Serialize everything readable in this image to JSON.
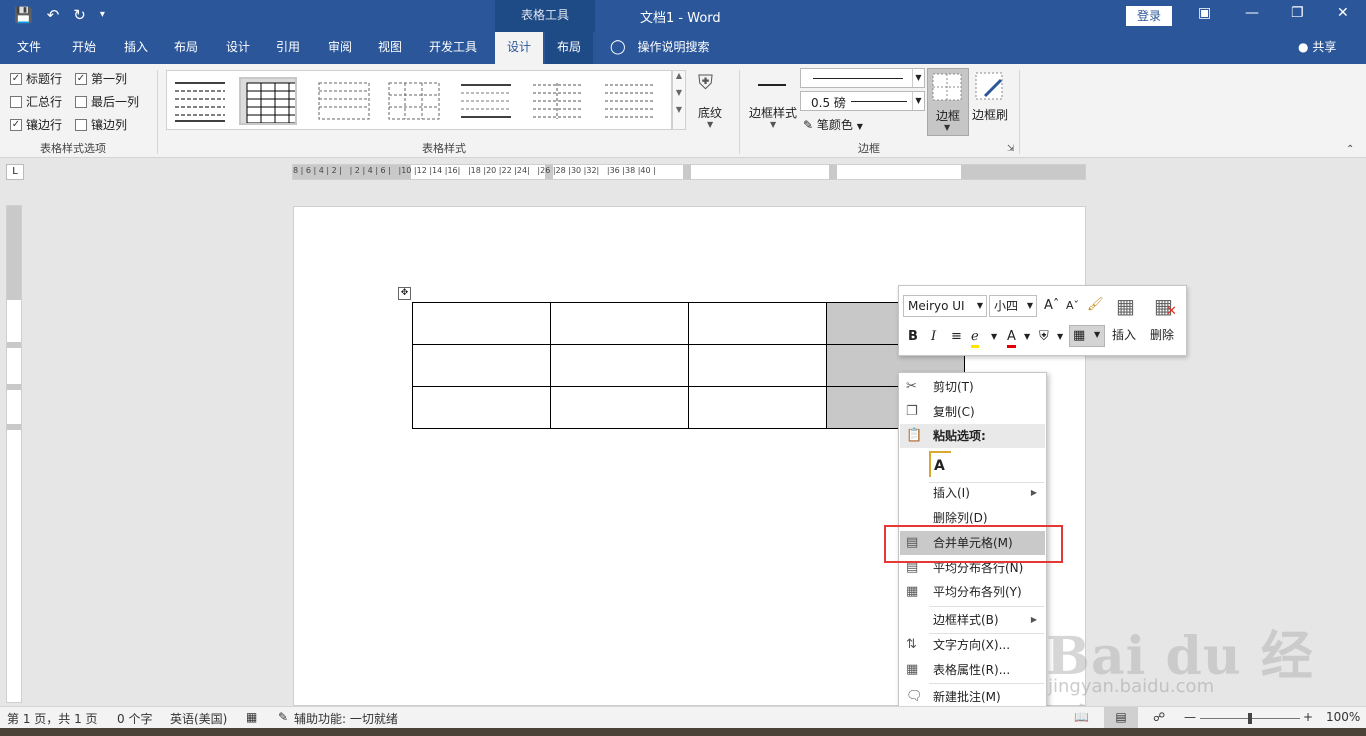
{
  "titlebar": {
    "context_tab": "表格工具",
    "doc_title": "文档1 - Word",
    "login": "登录"
  },
  "tabs": [
    "文件",
    "开始",
    "插入",
    "布局",
    "设计",
    "引用",
    "审阅",
    "视图",
    "开发工具",
    "设计",
    "布局"
  ],
  "search": "操作说明搜索",
  "share": "共享",
  "ribbon": {
    "checks": [
      {
        "label": "标题行",
        "checked": true
      },
      {
        "label": "汇总行",
        "checked": false
      },
      {
        "label": "镶边行",
        "checked": true
      },
      {
        "label": "第一列",
        "checked": true
      },
      {
        "label": "最后一列",
        "checked": false
      },
      {
        "label": "镶边列",
        "checked": false
      }
    ],
    "group_style_options": "表格样式选项",
    "group_table_styles": "表格样式",
    "shading": "底纹",
    "border_styles": "边框样式",
    "weight": "0.5 磅",
    "pen_color": "笔颜色",
    "borders": "边框",
    "border_painter": "边框刷",
    "group_borders": "边框"
  },
  "ruler": {
    "h_ticks": "8 | 6 | 4 | 2 |   | 2 | 4 | 6 |   |10 |12 |14 |16|   |18 |20 |22 |24|   |26 |28 |30 |32|   |36 |38 |40 |",
    "corner": "L"
  },
  "mini_toolbar": {
    "font": "Meiryo UI",
    "size": "小四",
    "insert": "插入",
    "delete": "删除"
  },
  "context_menu": {
    "items": [
      {
        "label": "剪切(T)",
        "icon": "scissors-icon"
      },
      {
        "label": "复制(C)",
        "icon": "copy-icon"
      },
      {
        "label": "粘贴选项:",
        "icon": "paste-icon"
      },
      {
        "label": "插入(I)"
      },
      {
        "label": "删除列(D)"
      },
      {
        "label": "合并单元格(M)",
        "icon": "merge-cells-icon"
      },
      {
        "label": "平均分布各行(N)",
        "icon": "distribute-rows-icon"
      },
      {
        "label": "平均分布各列(Y)",
        "icon": "distribute-columns-icon"
      },
      {
        "label": "边框样式(B)"
      },
      {
        "label": "文字方向(X)...",
        "icon": "text-direction-icon"
      },
      {
        "label": "表格属性(R)...",
        "icon": "table-properties-icon"
      },
      {
        "label": "新建批注(M)",
        "icon": "comment-icon"
      }
    ]
  },
  "status": {
    "page": "第 1 页，共 1 页",
    "words": "0 个字",
    "language": "英语(美国)",
    "accessibility": "辅助功能: 一切就绪",
    "zoom": "100%"
  },
  "watermark": {
    "brand": "Bai du 经验",
    "url": "jingyan.baidu.com"
  }
}
